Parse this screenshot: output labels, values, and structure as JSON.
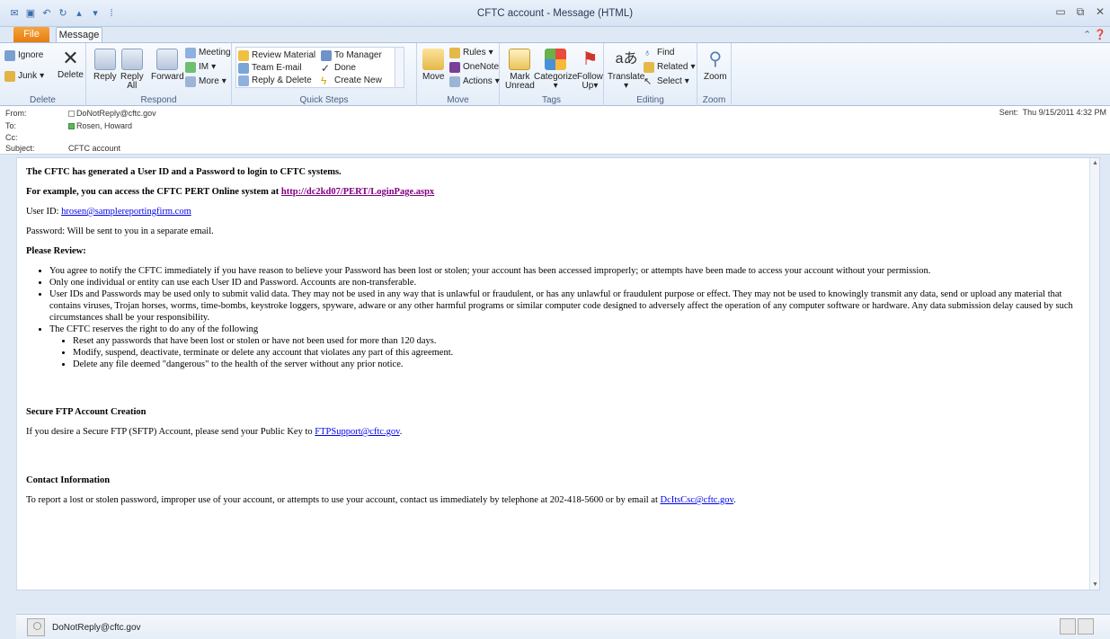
{
  "window": {
    "title": "CFTC account - Message (HTML)"
  },
  "tabs": [
    {
      "label": "File"
    },
    {
      "label": "Message"
    }
  ],
  "ribbon": {
    "delete": {
      "label": "Delete",
      "ignore": "Ignore",
      "junk": "Junk",
      "delete_btn": "Delete"
    },
    "respond": {
      "label": "Respond",
      "reply": "Reply",
      "reply_all_1": "Reply",
      "reply_all_2": "All",
      "forward": "Forward",
      "meeting": "Meeting",
      "im": "IM",
      "more": "More"
    },
    "quick_steps": {
      "label": "Quick Steps",
      "items": [
        "Review Material",
        "To Manager",
        "Team E-mail",
        "Done",
        "Reply & Delete",
        "Create New"
      ]
    },
    "move": {
      "label": "Move",
      "move_btn": "Move",
      "rules": "Rules",
      "onenote": "OneNote",
      "actions": "Actions"
    },
    "tags": {
      "label": "Tags",
      "mark_unread_1": "Mark",
      "mark_unread_2": "Unread",
      "categorize": "Categorize",
      "follow_up_1": "Follow",
      "follow_up_2": "Up"
    },
    "editing": {
      "label": "Editing",
      "translate": "Translate",
      "find": "Find",
      "related": "Related",
      "select": "Select"
    },
    "zoom": {
      "label": "Zoom",
      "zoom_btn": "Zoom"
    }
  },
  "header": {
    "from_label": "From:",
    "from_value": "DoNotReply@cftc.gov",
    "to_label": "To:",
    "to_value": "Rosen, Howard",
    "cc_label": "Cc:",
    "subject_label": "Subject:",
    "subject_value": "CFTC account",
    "sent_label": "Sent:",
    "sent_value": "Thu 9/15/2011 4:32 PM"
  },
  "body": {
    "line1": "The CFTC has generated a User ID and a Password to login to CFTC systems.",
    "line2_prefix": "For example, you can access the CFTC PERT Online system at ",
    "line2_link": "http://dc2kd07/PERT/LoginPage.aspx",
    "userid_prefix": "User ID: ",
    "userid_link": "hrosen@samplereportingfirm.com",
    "password_line": "Password: Will be sent to you in a separate email.",
    "review_heading": "Please Review:",
    "bullets": [
      "You agree to notify the CFTC immediately if you have reason to believe your Password has been lost or stolen; your account has been accessed improperly; or attempts have been made to access your account without your permission.",
      "Only one individual or entity can use each User ID and Password.  Accounts are non-transferable.",
      "User IDs and Passwords may be used only to submit valid data. They may not be used in any way that is unlawful or fraudulent, or has any unlawful or fraudulent purpose or effect. They may not be used to knowingly transmit any data, send or upload any material that contains viruses, Trojan horses, worms, time-bombs, keystroke loggers, spyware, adware or any other harmful programs or similar computer code designed to adversely affect the operation of any computer software or hardware. Any data submission delay caused by such circumstances shall be your responsibility.",
      "The CFTC reserves the right to do any of the following"
    ],
    "sub_bullets": [
      "Reset any passwords that have been lost or stolen or have not been used for more than 120 days.",
      "Modify, suspend, deactivate, terminate or delete any account that violates any part of this agreement.",
      "Delete any file deemed \"dangerous\" to the health of the server without any prior notice."
    ],
    "sftp_heading": "Secure FTP Account Creation",
    "sftp_prefix": "If you desire a Secure FTP (SFTP) Account, please send your Public Key to ",
    "sftp_link": "FTPSupport@cftc.gov",
    "sftp_suffix": ".",
    "contact_heading": "Contact Information",
    "contact_prefix": "To report a lost or stolen password, improper use of your account, or attempts to use your account, contact us immediately by telephone at 202-418-5600 or by email at ",
    "contact_link": "DcItsCsc@cftc.gov",
    "contact_suffix": "."
  },
  "people_pane": {
    "name": "DoNotReply@cftc.gov"
  }
}
